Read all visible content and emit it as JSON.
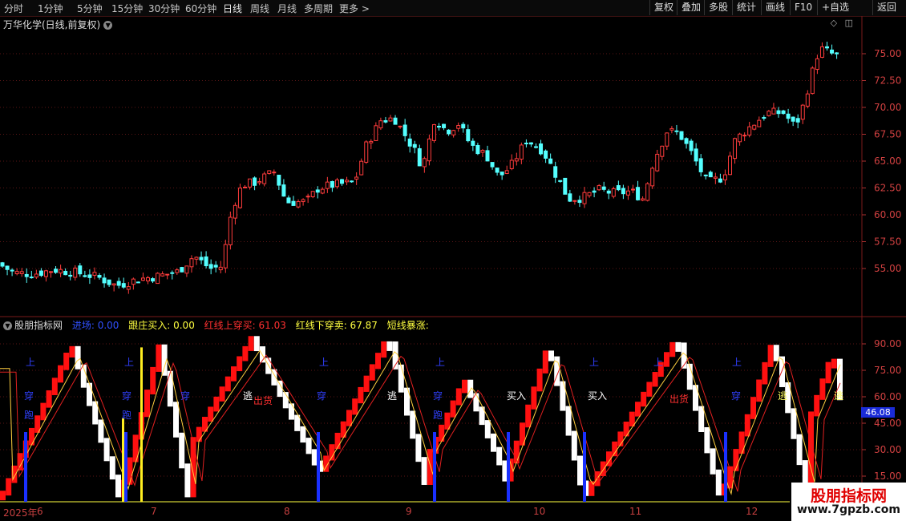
{
  "toolbar": {
    "periods": [
      "分时",
      "1分钟",
      "5分钟",
      "15分钟",
      "30分钟",
      "60分钟",
      "日线",
      "周线",
      "月线",
      "多周期",
      "更多 >"
    ],
    "active_period": "日线",
    "tools": [
      "复权",
      "叠加",
      "多股",
      "统计",
      "画线",
      "F10",
      "+自选",
      "返回"
    ]
  },
  "main_chart": {
    "title": "万华化学(日线,前复权)",
    "y_ticks": [
      "75.00",
      "72.50",
      "70.00",
      "67.50",
      "65.00",
      "62.50",
      "60.00",
      "57.50",
      "55.00"
    ],
    "up_color": "#ff3c3c",
    "down_color": "#54ffff"
  },
  "indicator": {
    "name": "股朋指标网",
    "legend": [
      {
        "text": "进场: 0.00",
        "color": "#3050ff"
      },
      {
        "text": "跟庄买入: 0.00",
        "color": "#ffff40"
      },
      {
        "text": "红线上穿买: 61.03",
        "color": "#ff3030"
      },
      {
        "text": "红线下穿卖: 67.87",
        "color": "#ffff40"
      },
      {
        "text": "短线暴涨:",
        "color": "#ffff40"
      }
    ],
    "y_ticks": [
      "90.00",
      "75.00",
      "60.00",
      "45.00",
      "30.00",
      "15.00"
    ],
    "current_value": "46.08",
    "labels": [
      "上",
      "上",
      "上",
      "上",
      "上",
      "上",
      "上",
      "穿",
      "穿",
      "穿",
      "穿",
      "穿",
      "穿",
      "买入",
      "买入",
      "逃",
      "逃",
      "逃",
      "逃",
      "出货",
      "出货",
      "跑",
      "跑",
      "跑"
    ]
  },
  "dates": [
    "2025年",
    "6",
    "7",
    "8",
    "9",
    "10",
    "11",
    "12"
  ],
  "watermark": {
    "brand": "股朋指标网",
    "site": "www.7gpzb.com"
  }
}
